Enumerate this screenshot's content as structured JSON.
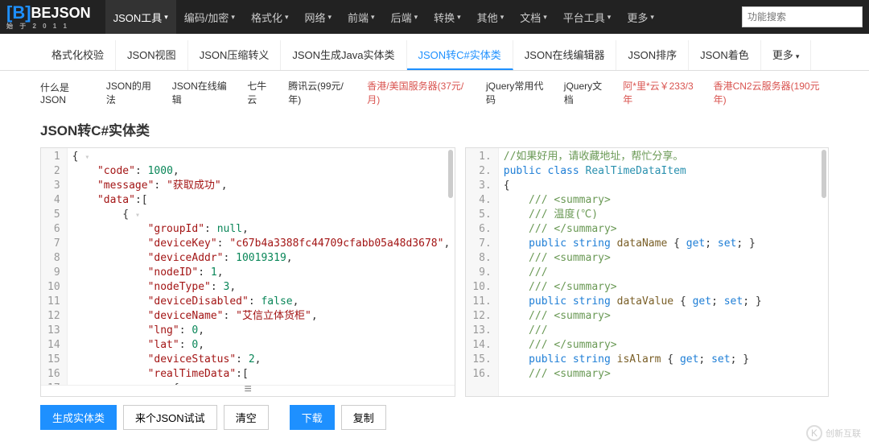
{
  "logo": {
    "brand": "BEJSON",
    "sub": "始 于 2 0 1 1"
  },
  "nav": [
    {
      "label": "JSON工具",
      "active": true,
      "caret": true
    },
    {
      "label": "编码/加密",
      "caret": true
    },
    {
      "label": "格式化",
      "caret": true
    },
    {
      "label": "网络",
      "caret": true
    },
    {
      "label": "前端",
      "caret": true
    },
    {
      "label": "后端",
      "caret": true
    },
    {
      "label": "转换",
      "caret": true
    },
    {
      "label": "其他",
      "caret": true
    },
    {
      "label": "文档",
      "caret": true
    },
    {
      "label": "平台工具",
      "caret": true
    },
    {
      "label": "更多",
      "caret": true
    }
  ],
  "search": {
    "placeholder": "功能搜索"
  },
  "subtabs": [
    {
      "label": "格式化校验"
    },
    {
      "label": "JSON视图"
    },
    {
      "label": "JSON压缩转义"
    },
    {
      "label": "JSON生成Java实体类"
    },
    {
      "label": "JSON转C#实体类",
      "active": true
    },
    {
      "label": "JSON在线编辑器"
    },
    {
      "label": "JSON排序"
    },
    {
      "label": "JSON着色"
    },
    {
      "label": "更多",
      "more": true
    }
  ],
  "links": [
    {
      "label": "什么是JSON"
    },
    {
      "label": "JSON的用法"
    },
    {
      "label": "JSON在线编辑"
    },
    {
      "label": "七牛云"
    },
    {
      "label": "腾讯云(99元/年)"
    },
    {
      "label": "香港/美国服务器(37元/月)",
      "promo": true
    },
    {
      "label": "jQuery常用代码"
    },
    {
      "label": "jQuery文档"
    },
    {
      "label": "阿*里*云￥233/3年",
      "promo": true
    },
    {
      "label": "香港CN2云服务器(190元年)",
      "promo": true
    }
  ],
  "title": "JSON转C#实体类",
  "json_lines": [
    "{",
    "    \"code\":1000,",
    "    \"message\":\"获取成功\",",
    "    \"data\":[",
    "        {",
    "            \"groupId\":null,",
    "            \"deviceKey\":\"c67b4a3388fc44709cfabb05a48d3678\",",
    "            \"deviceAddr\":10019319,",
    "            \"nodeID\":1,",
    "            \"nodeType\":3,",
    "            \"deviceDisabled\":false,",
    "            \"deviceName\":\"艾信立体货柜\",",
    "            \"lng\":0,",
    "            \"lat\":0,",
    "            \"deviceStatus\":2,",
    "            \"realTimeData\":[",
    "                {"
  ],
  "cs_lines": [
    {
      "t": "//如果好用，请收藏地址，帮忙分享。",
      "c": "cmt"
    },
    {
      "t": "public class RealTimeDataItem",
      "c": "decl"
    },
    {
      "t": "{",
      "c": "br"
    },
    {
      "t": "    /// <summary>",
      "c": "cmt"
    },
    {
      "t": "    /// 温度(℃)",
      "c": "cmt"
    },
    {
      "t": "    /// </summary>",
      "c": "cmt"
    },
    {
      "t": "    public string dataName { get; set; }",
      "c": "prop"
    },
    {
      "t": "    /// <summary>",
      "c": "cmt"
    },
    {
      "t": "    ///",
      "c": "cmt"
    },
    {
      "t": "    /// </summary>",
      "c": "cmt"
    },
    {
      "t": "    public string dataValue { get; set; }",
      "c": "prop"
    },
    {
      "t": "    /// <summary>",
      "c": "cmt"
    },
    {
      "t": "    ///",
      "c": "cmt"
    },
    {
      "t": "    /// </summary>",
      "c": "cmt"
    },
    {
      "t": "    public string isAlarm { get; set; }",
      "c": "prop"
    },
    {
      "t": "    /// <summary>",
      "c": "cmt"
    }
  ],
  "handle_glyph": "≡",
  "buttons": [
    {
      "label": "生成实体类",
      "primary": true
    },
    {
      "label": "来个JSON试试"
    },
    {
      "label": "清空"
    },
    {
      "label": "下载",
      "primary": true
    },
    {
      "label": "复制"
    }
  ],
  "watermark": {
    "icon": "K",
    "text": "创新互联"
  }
}
